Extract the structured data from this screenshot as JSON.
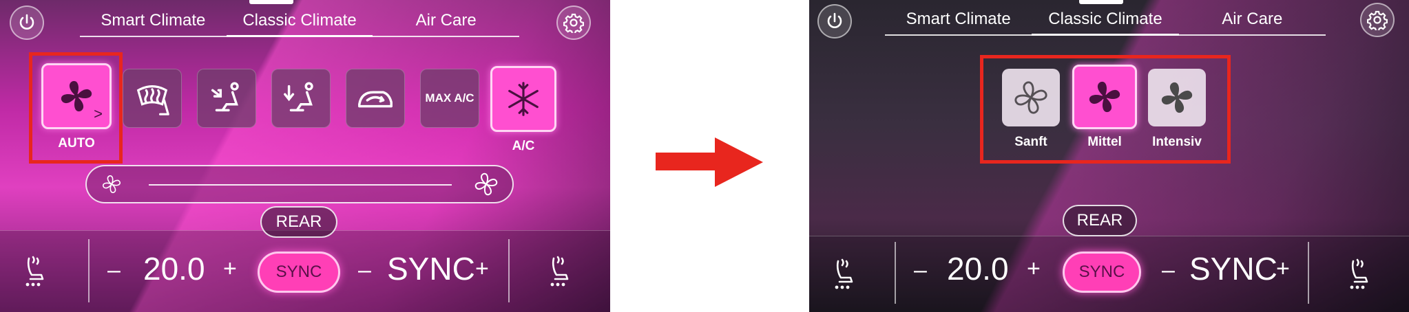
{
  "left_screen": {
    "tabs": [
      "Smart Climate",
      "Classic Climate",
      "Air Care"
    ],
    "tiles": {
      "auto_label": "AUTO",
      "max_ac_label": "MAX A/C",
      "ac_label": "A/C"
    },
    "bottom": {
      "rear_label": "REAR",
      "minus_left": "–",
      "temperature": "20.0",
      "plus_left": "+",
      "sync_label": "SYNC",
      "minus_right": "–",
      "right_value": "SYNC",
      "plus_right": "+"
    }
  },
  "right_screen": {
    "tabs": [
      "Smart Climate",
      "Classic Climate",
      "Air Care"
    ],
    "fan_options": [
      "Sanft",
      "Mittel",
      "Intensiv"
    ],
    "selected_option": "Mittel",
    "bottom": {
      "rear_label": "REAR",
      "minus_left": "–",
      "temperature": "20.0",
      "plus_left": "+",
      "sync_label": "SYNC",
      "minus_right": "–",
      "right_value": "SYNC",
      "plus_right": "+"
    }
  },
  "colors": {
    "highlight_box": "#e8261e",
    "arrow": "#e8261e",
    "active_pink": "#ff4fd0"
  },
  "icons": [
    "power-icon",
    "gear-icon",
    "fan-icon",
    "windshield-heat-icon",
    "vent-upper-icon",
    "vent-lower-icon",
    "recirculation-icon",
    "snowflake-icon",
    "seat-heat-icon"
  ]
}
